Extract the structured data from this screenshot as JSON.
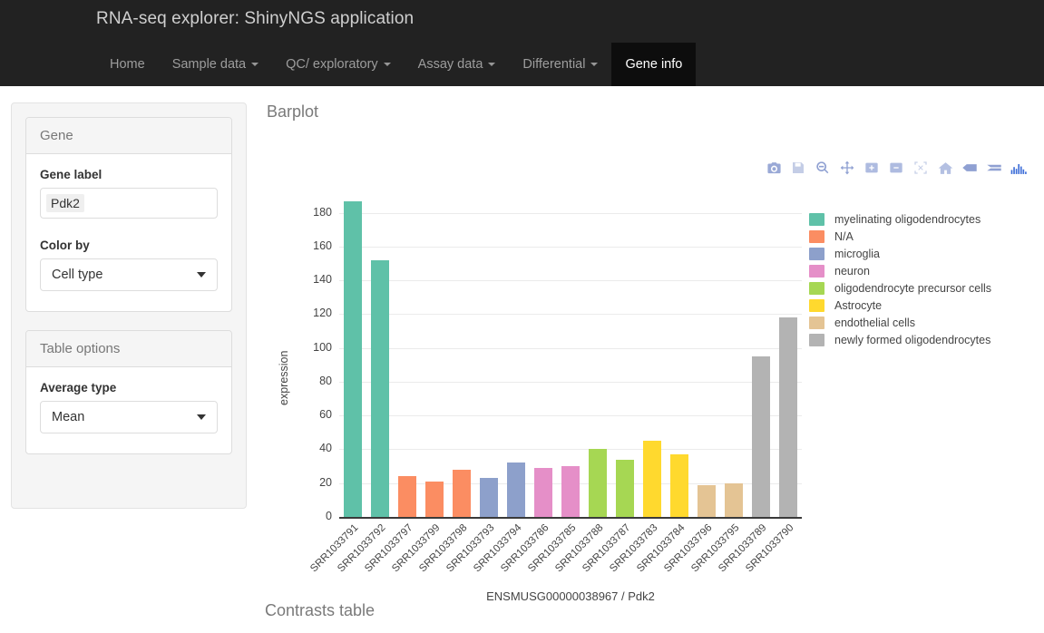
{
  "navbar": {
    "brand": "RNA-seq explorer: ShinyNGS application",
    "items": [
      {
        "label": "Home",
        "caret": false,
        "active": false
      },
      {
        "label": "Sample data",
        "caret": true,
        "active": false
      },
      {
        "label": "QC/ exploratory",
        "caret": true,
        "active": false
      },
      {
        "label": "Assay data",
        "caret": true,
        "active": false
      },
      {
        "label": "Differential",
        "caret": true,
        "active": false
      },
      {
        "label": "Gene info",
        "caret": false,
        "active": true
      }
    ]
  },
  "sidebar": {
    "panels": [
      {
        "heading": "Gene",
        "fields": [
          {
            "label": "Gene label",
            "type": "token",
            "value": "Pdk2"
          },
          {
            "label": "Color by",
            "type": "select",
            "value": "Cell type"
          }
        ]
      },
      {
        "heading": "Table options",
        "fields": [
          {
            "label": "Average type",
            "type": "select",
            "value": "Mean"
          }
        ]
      }
    ]
  },
  "main": {
    "plot_title": "Barplot",
    "footer_title": "Contrasts table",
    "modebar": [
      {
        "name": "camera-icon",
        "title": "Download plot as a png"
      },
      {
        "name": "disk-icon",
        "title": "Edit in Chart Studio"
      },
      {
        "name": "zoom-magnifier-icon",
        "title": "Zoom"
      },
      {
        "name": "pan-arrows-icon",
        "title": "Pan"
      },
      {
        "name": "zoom-in-icon",
        "title": "Zoom in"
      },
      {
        "name": "zoom-out-icon",
        "title": "Zoom out"
      },
      {
        "name": "autoscale-icon",
        "title": "Autoscale"
      },
      {
        "name": "home-reset-axes-icon",
        "title": "Reset axes"
      },
      {
        "name": "toggle-spikelines-icon",
        "title": "Toggle Spike Lines"
      },
      {
        "name": "hover-compare-icon",
        "title": "Compare data on hover"
      },
      {
        "name": "plotly-logo-icon",
        "title": "Produced with Plotly"
      }
    ]
  },
  "chart_data": {
    "type": "bar",
    "title": "",
    "xlabel": "ENSMUSG00000038967 / Pdk2",
    "ylabel": "expression",
    "ylim": [
      0,
      190
    ],
    "yticks": [
      0,
      20,
      40,
      60,
      80,
      100,
      120,
      140,
      160,
      180
    ],
    "grid": true,
    "legend_position": "right",
    "categories": [
      "SRR1033791",
      "SRR1033792",
      "SRR1033797",
      "SRR1033799",
      "SRR1033798",
      "SRR1033793",
      "SRR1033794",
      "SRR1033786",
      "SRR1033785",
      "SRR1033788",
      "SRR1033787",
      "SRR1033783",
      "SRR1033784",
      "SRR1033796",
      "SRR1033795",
      "SRR1033789",
      "SRR1033790"
    ],
    "values": [
      187,
      152,
      24,
      21,
      28,
      23,
      32,
      29,
      30,
      40,
      34,
      45,
      37,
      19,
      20,
      95,
      118
    ],
    "point_groups": [
      "myelinating oligodendrocytes",
      "myelinating oligodendrocytes",
      "N/A",
      "N/A",
      "N/A",
      "microglia",
      "microglia",
      "neuron",
      "neuron",
      "oligodendrocyte precursor cells",
      "oligodendrocyte precursor cells",
      "Astrocyte",
      "Astrocyte",
      "endothelial cells",
      "endothelial cells",
      "newly formed oligodendrocytes",
      "newly formed oligodendrocytes"
    ],
    "bar_colors": [
      "#5FC1A8",
      "#5FC1A8",
      "#FB8D62",
      "#FB8D62",
      "#FB8D62",
      "#8DA0CB",
      "#8DA0CB",
      "#E58FC8",
      "#E58FC8",
      "#A6D753",
      "#A6D753",
      "#FFD92E",
      "#FFD92E",
      "#E4C494",
      "#E4C494",
      "#B3B3B3",
      "#B3B3B3"
    ],
    "legend": [
      {
        "label": "myelinating oligodendrocytes",
        "color": "#5FC1A8"
      },
      {
        "label": "N/A",
        "color": "#FB8D62"
      },
      {
        "label": "microglia",
        "color": "#8DA0CB"
      },
      {
        "label": "neuron",
        "color": "#E58FC8"
      },
      {
        "label": "oligodendrocyte precursor cells",
        "color": "#A6D753"
      },
      {
        "label": "Astrocyte",
        "color": "#FFD92E"
      },
      {
        "label": "endothelial cells",
        "color": "#E4C494"
      },
      {
        "label": "newly formed oligodendrocytes",
        "color": "#B3B3B3"
      }
    ]
  }
}
